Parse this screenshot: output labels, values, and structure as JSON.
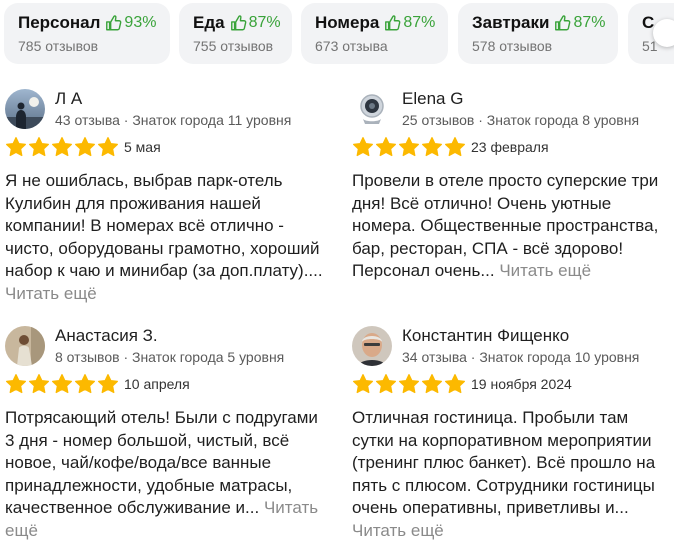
{
  "aspects": [
    {
      "name": "Персонал",
      "percent": "93%",
      "count": "785 отзывов"
    },
    {
      "name": "Еда",
      "percent": "87%",
      "count": "755 отзывов"
    },
    {
      "name": "Номера",
      "percent": "87%",
      "count": "673 отзыва"
    },
    {
      "name": "Завтраки",
      "percent": "87%",
      "count": "578 отзывов"
    },
    {
      "name": "С",
      "percent": "",
      "count": "51"
    }
  ],
  "colors": {
    "star": "#fcb900",
    "positive": "#3aa33a",
    "chip_bg": "#f2f3f5",
    "read_more": "#8a8a8a"
  },
  "icons": {
    "thumb": "thumbs-up-icon",
    "star": "star-icon",
    "scroll": "scroll-right-arrow"
  },
  "reviews": [
    {
      "author": "Л А",
      "meta": "43 отзыва · Знаток города 11 уровня",
      "rating": 5,
      "date": "5 мая",
      "text": "Я не ошиблась, выбрав парк-отель Кулибин для проживания нашей компании! В номерах всё отлично - чисто, оборудованы грамотно, хороший набор к чаю и минибар (за доп.плату)....",
      "read_more": "Читать ещё"
    },
    {
      "author": "Elena G",
      "meta": "25 отзывов · Знаток города 8 уровня",
      "rating": 5,
      "date": "23 февраля",
      "text": "Провели в отеле просто суперские три дня! Всё отлично! Очень уютные номера. Общественные пространства, бар, ресторан, СПА - всё здорово! Персонал очень...",
      "read_more": "Читать ещё"
    },
    {
      "author": "Анастасия З.",
      "meta": "8 отзывов · Знаток города 5 уровня",
      "rating": 5,
      "date": "10 апреля",
      "text": "Потрясающий отель! Были с подругами 3 дня - номер большой, чистый, всё новое, чай/кофе/вода/все ванные принадлежности, удобные матрасы, качественное обслуживание и...",
      "read_more": "Читать ещё"
    },
    {
      "author": "Константин Фищенко",
      "meta": "34 отзыва · Знаток города 10 уровня",
      "rating": 5,
      "date": "19 ноября 2024",
      "text": "Отличная гостиница. Пробыли там сутки на корпоративном мероприятии (тренинг плюс банкет). Всё прошло на пять с плюсом. Сотрудники гостиницы очень оперативны, приветливы и...",
      "read_more": "Читать ещё"
    }
  ]
}
